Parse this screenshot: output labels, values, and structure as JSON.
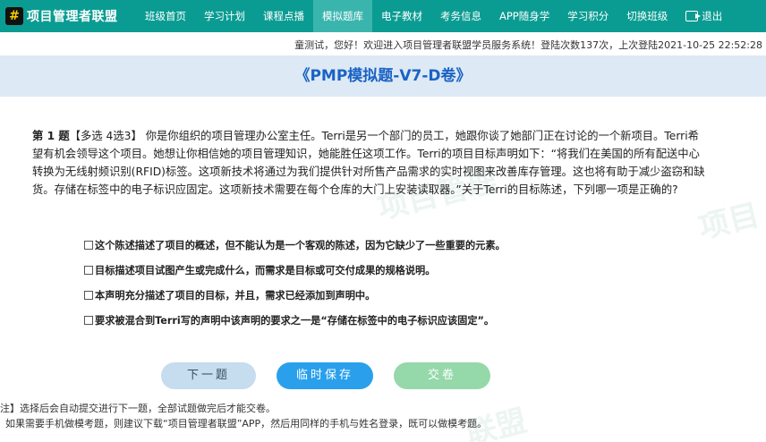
{
  "brand": {
    "name": "项目管理者联盟",
    "mark": "#",
    "accent": "#0a9c92"
  },
  "nav": {
    "items": [
      {
        "label": "班级首页"
      },
      {
        "label": "学习计划"
      },
      {
        "label": "课程点播"
      },
      {
        "label": "模拟题库",
        "active": true
      },
      {
        "label": "电子教材"
      },
      {
        "label": "考务信息"
      },
      {
        "label": "APP随身学"
      },
      {
        "label": "学习积分"
      },
      {
        "label": "切换班级"
      }
    ],
    "logout_label": "退出"
  },
  "welcome": "童测试，您好！欢迎进入项目管理者联盟学员服务系统！登陆次数137次，上次登陆2021-10-25 22:52:28",
  "exam": {
    "title": "《PMP模拟题-V7-D卷》"
  },
  "question": {
    "number_label": "第 1 题",
    "type_label": "【多选  4选3】",
    "text": "你是你组织的项目管理办公室主任。Terri是另一个部门的员工，她跟你谈了她部门正在讨论的一个新项目。Terri希望有机会领导这个项目。她想让你相信她的项目管理知识，她能胜任这项工作。Terri的项目目标声明如下：“将我们在美国的所有配送中心转换为无线射频识别(RFID)标签。这项新技术将通过为我们提供针对所售产品需求的实时视图来改善库存管理。这也将有助于减少盗窃和缺货。存储在标签中的电子标识应固定。这项新技术需要在每个仓库的大门上安装读取器。”关于Terri的目标陈述，下列哪一项是正确的?",
    "options": [
      "这个陈述描述了项目的概述，但不能认为是一个客观的陈述，因为它缺少了一些重要的元素。",
      "目标描述项目试图产生或完成什么，而需求是目标或可交付成果的规格说明。",
      "本声明充分描述了项目的目标，并且，需求已经添加到声明中。",
      "要求被混合到Terri写的声明中该声明的要求之一是“存储在标签中的电子标识应该固定”。"
    ]
  },
  "buttons": {
    "next": "下一题",
    "save": "临时保存",
    "submit": "交卷"
  },
  "notes": {
    "line1": "注】选择后会自动提交进行下一题，全部试题做完后才能交卷。",
    "line2": "如果需要手机做模考题，则建议下载“项目管理者联盟”APP，然后用同样的手机与姓名登录，既可以做模考题。"
  },
  "icons": {
    "logo": "brand-logo-icon",
    "logout": "logout-icon",
    "checkbox": "checkbox-icon"
  }
}
